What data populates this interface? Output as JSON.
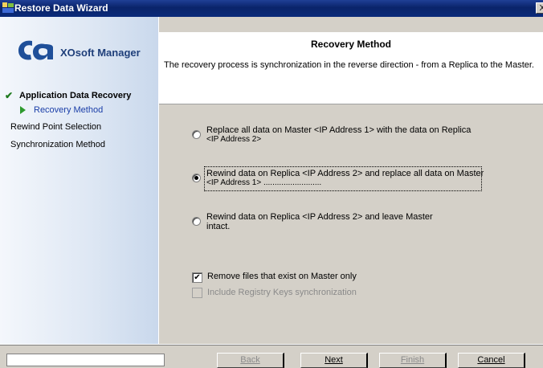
{
  "window": {
    "title": "Restore Data Wizard",
    "close_glyph": "X"
  },
  "brand": {
    "logo_text": "ca",
    "product": "XOsoft Manager"
  },
  "steps": {
    "main": "Application Data Recovery",
    "current": "Recovery Method",
    "items": [
      "Rewind Point Selection",
      "Synchronization Method"
    ]
  },
  "header": {
    "title": "Recovery Method",
    "description": "The recovery process is synchronization in the reverse direction - from a Replica to the Master."
  },
  "options": [
    {
      "line1": "Replace all data on Master  <IP Address 1>    with the data on Replica",
      "line2": "<IP Address 2>",
      "checked": false
    },
    {
      "line1": "Rewind data on Replica  <IP Address 2>    and replace all data on Master",
      "line2": "<IP Address 1>  ..........................",
      "checked": true
    },
    {
      "line1": "Rewind data on Replica  <IP Address 2>    and leave Master",
      "line2": "intact.",
      "checked": false
    }
  ],
  "checkboxes": {
    "remove_files": {
      "label": "Remove files that exist on Master only",
      "checked": true,
      "mark": "✔"
    },
    "registry": {
      "label": "Include Registry Keys synchronization",
      "checked": false,
      "enabled": false
    }
  },
  "buttons": {
    "back": "Back",
    "next": "Next",
    "finish": "Finish",
    "cancel": "Cancel"
  },
  "icons": {
    "check": "check-icon",
    "arrow": "arrow-right-icon",
    "app": "wizard-app-icon"
  },
  "colors": {
    "titlebar": "#0a246a",
    "accent_green": "#2e9a2e",
    "link_blue": "#1a3ea8"
  }
}
